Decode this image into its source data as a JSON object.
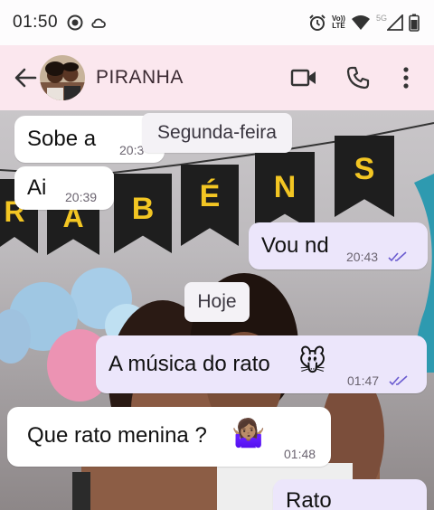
{
  "status_bar": {
    "time": "01:50",
    "volte_top": "Vo))",
    "volte_bottom": "LTE",
    "network_label": "5G"
  },
  "header": {
    "contact_name": "PIRANHA"
  },
  "wallpaper": {
    "banner_letters": [
      "R",
      "A",
      "B",
      "É",
      "N",
      "S"
    ]
  },
  "messages": [
    {
      "text": "Sobe a",
      "time": "20:3",
      "direction": "incoming"
    },
    {
      "text": "Ai",
      "time": "20:39",
      "direction": "incoming"
    },
    {
      "text": "Vou nd",
      "time": "20:43",
      "direction": "outgoing",
      "status": "read"
    },
    {
      "text": "A música do rato",
      "emoji": "🐭",
      "time": "01:47",
      "direction": "outgoing",
      "status": "read"
    },
    {
      "text": "Que rato menina ?",
      "emoji": "🤷🏽‍♀️",
      "time": "01:48",
      "direction": "incoming"
    },
    {
      "text": "Rato",
      "direction": "outgoing"
    }
  ],
  "date_chips": {
    "previous": "Segunda-feira",
    "today": "Hoje"
  },
  "colors": {
    "header_bg": "#fbe7ee",
    "outgoing_bubble": "#ece6fb",
    "incoming_bubble": "#ffffff",
    "read_ticks": "#6a5bd0",
    "banner_flag": "#1e1e1e",
    "banner_letter": "#f3c623"
  },
  "icons": {
    "back": "arrow-left-icon",
    "video_call": "video-camera-icon",
    "voice_call": "phone-icon",
    "menu": "more-vertical-icon"
  }
}
